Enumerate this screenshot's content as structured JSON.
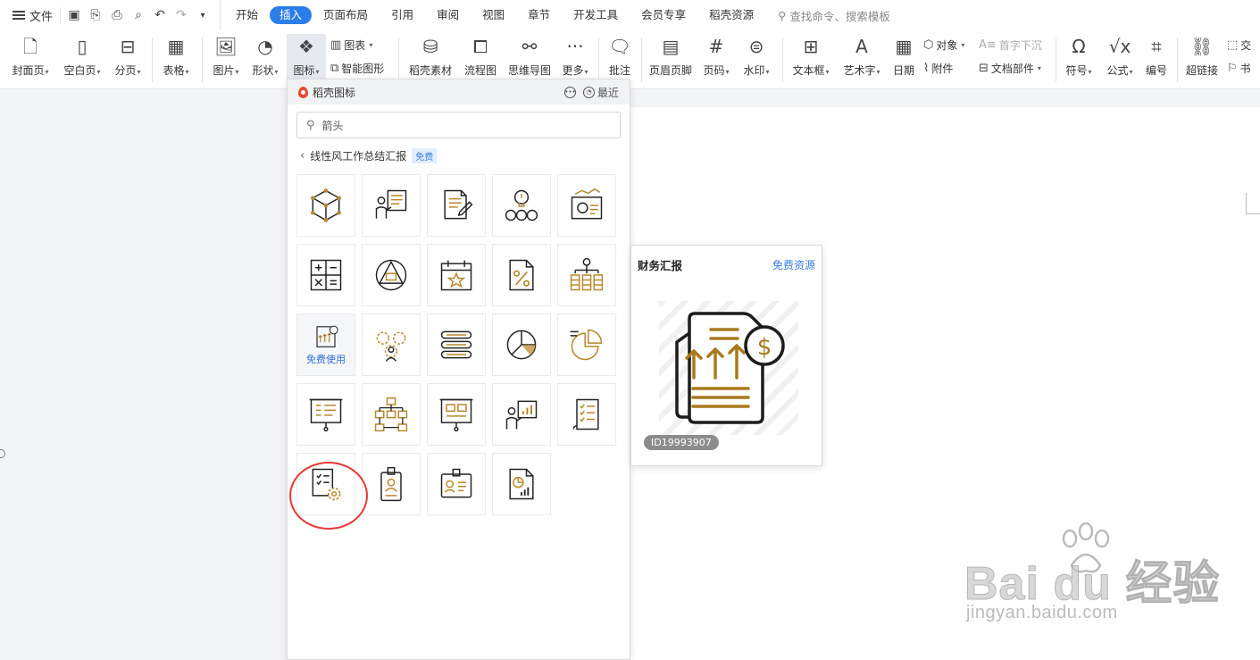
{
  "menubar": {
    "file_label": "文件",
    "tabs": [
      "开始",
      "插入",
      "页面布局",
      "引用",
      "审阅",
      "视图",
      "章节",
      "开发工具",
      "会员专享",
      "稻壳资源"
    ],
    "active_tab": "插入",
    "search_placeholder": "查找命令、搜索模板"
  },
  "ribbon": {
    "cover": "封面页",
    "blank": "空白页",
    "pagebreak": "分页",
    "table": "表格",
    "picture": "图片",
    "shape": "形状",
    "icon": "图标",
    "chart": "图表",
    "smartart": "智能图形",
    "docer_material": "稻壳素材",
    "flowchart": "流程图",
    "mindmap": "思维导图",
    "more": "更多",
    "comment": "批注",
    "header_footer": "页眉页脚",
    "page_number": "页码",
    "watermark": "水印",
    "textbox": "文本框",
    "wordart": "艺术字",
    "date": "日期",
    "object": "对象",
    "attachment": "附件",
    "dropcap": "首字下沉",
    "doc_parts": "文档部件",
    "symbol": "符号",
    "formula": "公式",
    "numbering": "编号",
    "hyperlink": "超链接",
    "cross_ref": "交",
    "bookmark": "书"
  },
  "icon_panel": {
    "title": "稻壳图标",
    "recent": "最近",
    "search_value": "箭头",
    "breadcrumb": "线性风工作总结汇报",
    "free_badge": "免费",
    "hover_action": "免费使用"
  },
  "preview": {
    "title": "财务汇报",
    "link": "免费资源",
    "id_label": "ID19993907"
  },
  "watermark": {
    "brand": "Bai du 经验",
    "url": "jingyan.baidu.com"
  },
  "colors": {
    "accent": "#2b7de9",
    "icon_gold": "#a87a1c",
    "icon_dark": "#222222",
    "highlight_ring": "#e53935"
  }
}
